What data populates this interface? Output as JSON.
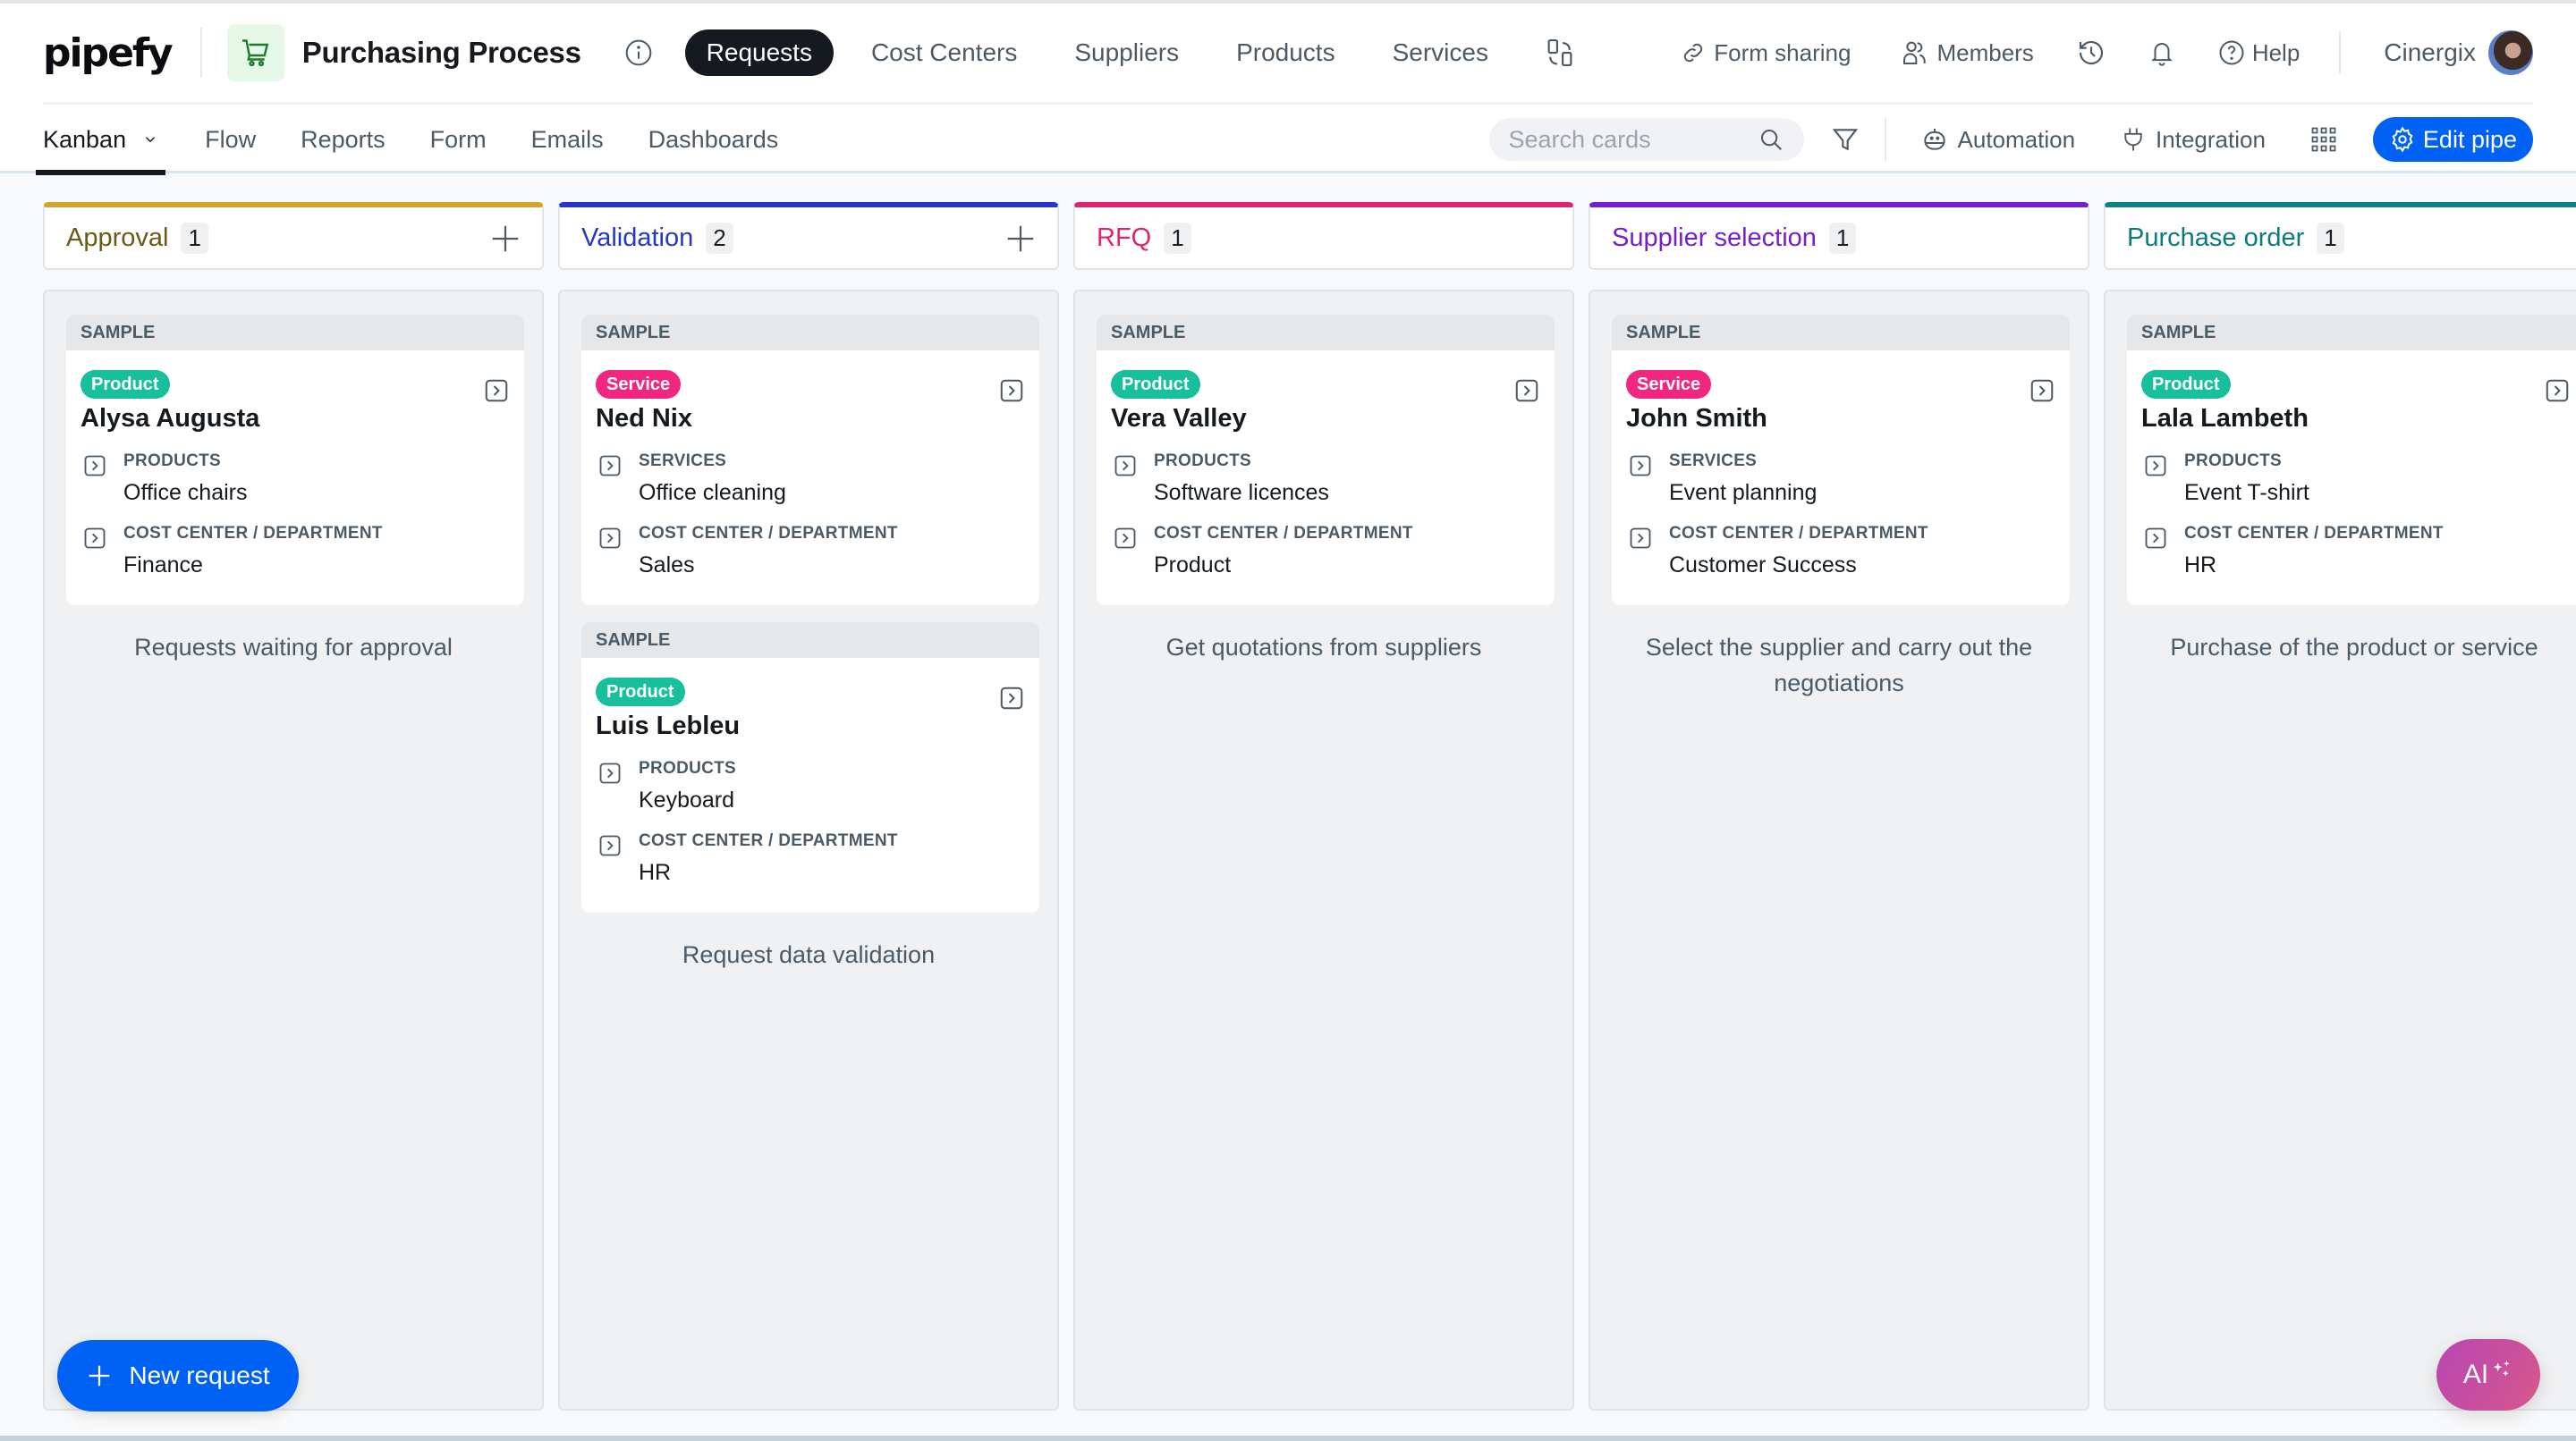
{
  "app": {
    "logo_text": "pipefy",
    "pipe_title": "Purchasing Process",
    "pipe_icon": "shopping-cart-icon",
    "pipe_icon_bg": "#e6f8e8",
    "pipe_icon_color": "#1f7a2e"
  },
  "top_nav": {
    "items": [
      {
        "label": "Requests",
        "active": true
      },
      {
        "label": "Cost Centers",
        "active": false
      },
      {
        "label": "Suppliers",
        "active": false
      },
      {
        "label": "Products",
        "active": false
      },
      {
        "label": "Services",
        "active": false
      }
    ],
    "switch_icon": "databases-switch-icon"
  },
  "top_tools": {
    "form_sharing": "Form sharing",
    "members": "Members",
    "help": "Help",
    "history_icon": "history-icon",
    "notifications_icon": "bell-icon",
    "user_name": "Cinergix"
  },
  "sub_nav": {
    "tabs": [
      {
        "label": "Kanban",
        "active": true,
        "has_dropdown": true
      },
      {
        "label": "Flow",
        "active": false
      },
      {
        "label": "Reports",
        "active": false
      },
      {
        "label": "Form",
        "active": false
      },
      {
        "label": "Emails",
        "active": false
      },
      {
        "label": "Dashboards",
        "active": false
      }
    ],
    "search_placeholder": "Search cards",
    "search_value": "",
    "automation": "Automation",
    "integration": "Integration",
    "edit_pipe": "Edit pipe"
  },
  "colors": {
    "accent": "#0062f5",
    "product_tag": "#17bf9b",
    "service_tag": "#f0267f",
    "ai_gradient_start": "#b746b4",
    "ai_gradient_end": "#d8578a"
  },
  "phases": [
    {
      "title": "Approval",
      "count": "1",
      "color": "#d3a42a",
      "title_color": "#6b5a14",
      "has_add": true,
      "description": "Requests waiting for approval",
      "cards": [
        {
          "sample_label": "SAMPLE",
          "tag": "Product",
          "tag_type": "product",
          "name": "Alysa Augusta",
          "fields": [
            {
              "label": "PRODUCTS",
              "value": "Office chairs"
            },
            {
              "label": "COST CENTER / DEPARTMENT",
              "value": "Finance"
            }
          ]
        }
      ]
    },
    {
      "title": "Validation",
      "count": "2",
      "color": "#2536c8",
      "title_color": "#2536c8",
      "has_add": true,
      "description": "Request data validation",
      "cards": [
        {
          "sample_label": "SAMPLE",
          "tag": "Service",
          "tag_type": "service",
          "name": "Ned Nix",
          "fields": [
            {
              "label": "SERVICES",
              "value": "Office cleaning"
            },
            {
              "label": "COST CENTER / DEPARTMENT",
              "value": "Sales"
            }
          ]
        },
        {
          "sample_label": "SAMPLE",
          "tag": "Product",
          "tag_type": "product",
          "name": "Luis Lebleu",
          "fields": [
            {
              "label": "PRODUCTS",
              "value": "Keyboard"
            },
            {
              "label": "COST CENTER / DEPARTMENT",
              "value": "HR"
            }
          ]
        }
      ]
    },
    {
      "title": "RFQ",
      "count": "1",
      "color": "#e0246e",
      "title_color": "#e0246e",
      "has_add": false,
      "description": "Get quotations from suppliers",
      "cards": [
        {
          "sample_label": "SAMPLE",
          "tag": "Product",
          "tag_type": "product",
          "name": "Vera Valley",
          "fields": [
            {
              "label": "PRODUCTS",
              "value": "Software licences"
            },
            {
              "label": "COST CENTER / DEPARTMENT",
              "value": "Product"
            }
          ]
        }
      ]
    },
    {
      "title": "Supplier selection",
      "count": "1",
      "color": "#7420cf",
      "title_color": "#7420cf",
      "has_add": false,
      "description": "Select the supplier and carry out the negotiations",
      "cards": [
        {
          "sample_label": "SAMPLE",
          "tag": "Service",
          "tag_type": "service",
          "name": "John Smith",
          "fields": [
            {
              "label": "SERVICES",
              "value": "Event planning"
            },
            {
              "label": "COST CENTER / DEPARTMENT",
              "value": "Customer Success"
            }
          ]
        }
      ]
    },
    {
      "title": "Purchase order",
      "count": "1",
      "color": "#0d8080",
      "title_color": "#0d7b7b",
      "has_add": false,
      "description": "Purchase of the product or service",
      "cards": [
        {
          "sample_label": "SAMPLE",
          "tag": "Product",
          "tag_type": "product",
          "name": "Lala Lambeth",
          "fields": [
            {
              "label": "PRODUCTS",
              "value": "Event T-shirt"
            },
            {
              "label": "COST CENTER / DEPARTMENT",
              "value": "HR"
            }
          ]
        }
      ]
    }
  ],
  "floating": {
    "new_request": "New request",
    "ai_label": "AI"
  }
}
